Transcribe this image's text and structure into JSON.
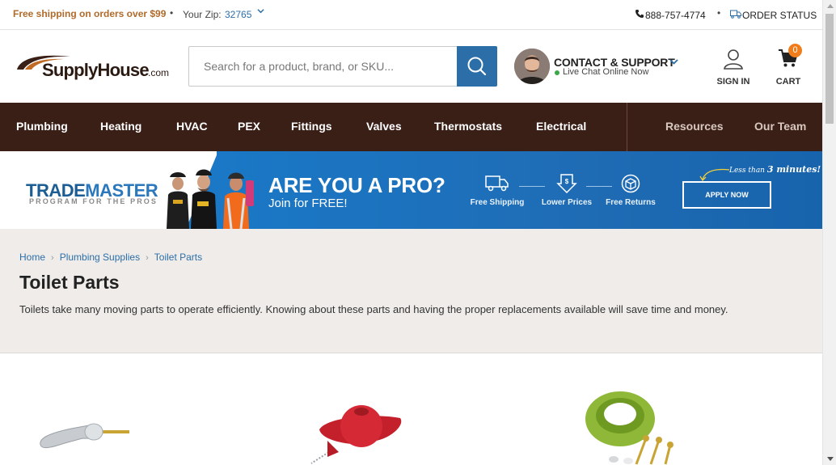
{
  "topbar": {
    "shipping_text": "Free shipping on orders over $99",
    "zip_label": "Your Zip:",
    "zip_value": "32765",
    "phone": "888-757-4774",
    "order_status": "ORDER STATUS"
  },
  "header": {
    "logo_brand": "SupplyHouse",
    "logo_tld": ".com",
    "search_placeholder": "Search for a product, brand, or SKU...",
    "contact_label": "CONTACT & SUPPORT",
    "live_chat": "Live Chat Online Now",
    "signin_label": "SIGN IN",
    "cart_label": "CART",
    "cart_count": "0"
  },
  "nav": {
    "items": [
      "Plumbing",
      "Heating",
      "HVAC",
      "PEX",
      "Fittings",
      "Valves",
      "Thermostats",
      "Electrical"
    ],
    "secondary": [
      "Resources",
      "Our Team"
    ]
  },
  "banner": {
    "program_title_a": "TRADE",
    "program_title_b": "MASTER",
    "program_sub": "PROGRAM FOR THE PROS",
    "headline": "ARE YOU A PRO?",
    "subheadline": "Join for FREE!",
    "perks": [
      "Free Shipping",
      "Lower Prices",
      "Free Returns"
    ],
    "cta": "APPLY NOW",
    "note_a": "Less than ",
    "note_b": "3 minutes!"
  },
  "category": {
    "breadcrumbs": [
      "Home",
      "Plumbing Supplies",
      "Toilet Parts"
    ],
    "title": "Toilet Parts",
    "description": "Toilets take many moving parts to operate efficiently. Knowing about these parts and having the proper replacements available will save time and money."
  },
  "colors": {
    "nav_bg": "#3a1f17",
    "accent_blue": "#2c6fa8",
    "shipping_orange": "#b06a2a",
    "cart_badge": "#f07d1b",
    "banner_blue": "#1a78c6"
  }
}
